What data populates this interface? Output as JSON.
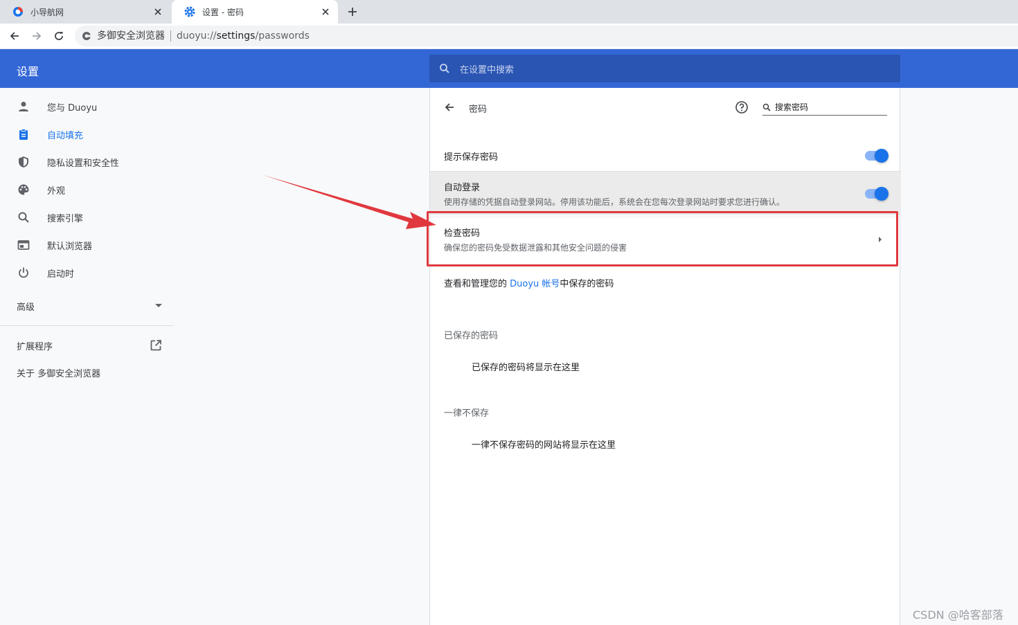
{
  "tabs": [
    {
      "title": "小导航网",
      "active": false
    },
    {
      "title": "设置 - 密码",
      "active": true
    }
  ],
  "omnibox": {
    "site_name": "多御安全浏览器",
    "url_scheme": "duoyu://",
    "url_host": "settings",
    "url_path": "/passwords"
  },
  "header": {
    "title": "设置",
    "search_placeholder": "在设置中搜索"
  },
  "sidebar": {
    "items": [
      {
        "label": "您与 Duoyu",
        "icon": "person-icon",
        "selected": false
      },
      {
        "label": "自动填充",
        "icon": "clipboard-icon",
        "selected": true
      },
      {
        "label": "隐私设置和安全性",
        "icon": "shield-icon",
        "selected": false
      },
      {
        "label": "外观",
        "icon": "palette-icon",
        "selected": false
      },
      {
        "label": "搜索引擎",
        "icon": "search-icon",
        "selected": false
      },
      {
        "label": "默认浏览器",
        "icon": "browser-window-icon",
        "selected": false
      },
      {
        "label": "启动时",
        "icon": "power-icon",
        "selected": false
      }
    ],
    "advanced": "高级",
    "extensions": "扩展程序",
    "about": "关于 多御安全浏览器"
  },
  "passwords": {
    "title": "密码",
    "search_placeholder": "搜索密码",
    "offer_to_save": {
      "label": "提示保存密码",
      "enabled": true
    },
    "auto_signin": {
      "label": "自动登录",
      "desc": "使用存储的凭据自动登录网站。停用该功能后，系统会在您每次登录网站时要求您进行确认。",
      "enabled": true
    },
    "check_passwords": {
      "label": "检查密码",
      "desc": "确保您的密码免受数据泄露和其他安全问题的侵害"
    },
    "manage_prefix": "查看和管理您的 ",
    "manage_link": "Duoyu 帐号",
    "manage_suffix": "中保存的密码",
    "saved_title": "已保存的密码",
    "saved_empty": "已保存的密码将显示在这里",
    "never_title": "一律不保存",
    "never_empty": "一律不保存密码的网站将显示在这里"
  },
  "colors": {
    "header": "#3467d6",
    "accent": "#1a73e8",
    "highlight": "#e0383e"
  },
  "watermark": "CSDN @哈客部落"
}
